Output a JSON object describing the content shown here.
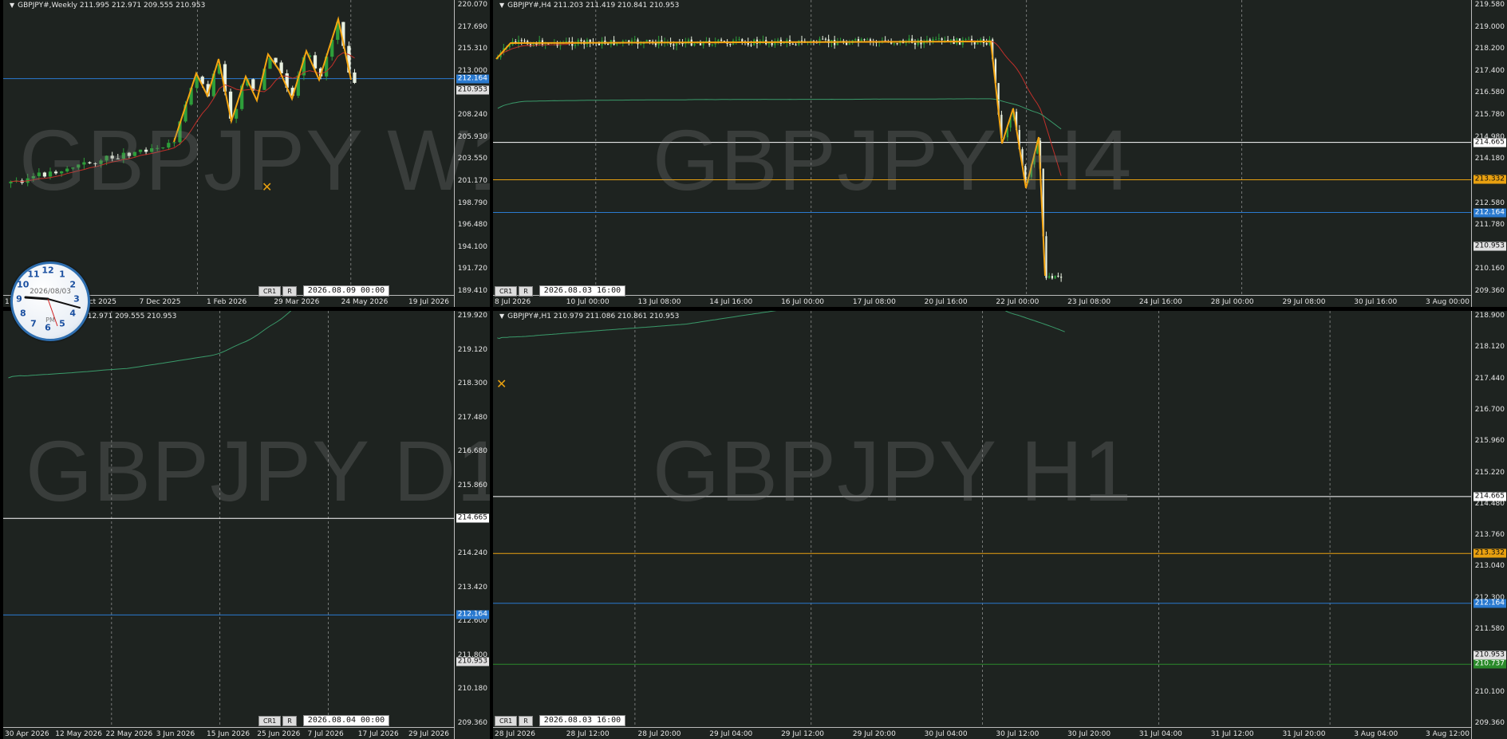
{
  "colors": {
    "bg": "#1e2320",
    "up": "#2e9e3a",
    "down": "#e8f0e0",
    "orange": "#f5a511",
    "ma_red": "#c0302a",
    "ma_green": "#3a9a6a",
    "h_white": "#ffffff",
    "h_orange": "#e8a010",
    "h_blue": "#2a7ad0",
    "h_green": "#2a8a2a"
  },
  "panels": [
    {
      "id": "w1",
      "title": "GBPJPY#,Weekly  211.995 212.971 209.555 210.953",
      "watermark": "GBPJPY W1",
      "price_min": 189.41,
      "price_max": 220.07,
      "y_labels": [
        "220.070",
        "217.690",
        "215.310",
        "213.000",
        "210.630",
        "208.240",
        "205.930",
        "203.550",
        "201.170",
        "198.790",
        "196.480",
        "194.100",
        "191.720",
        "189.410"
      ],
      "badges": [
        {
          "value": "212.164",
          "color": "#2a7ad0",
          "text": "#fff"
        },
        {
          "value": "210.953",
          "color": "#e0e0e0",
          "text": "#111"
        }
      ],
      "hlines": [
        {
          "price": 212.164,
          "color": "#2a7ad0"
        }
      ],
      "x_labels": [
        "17 Aug 2025",
        "12 Oct 2025",
        "7 Dec 2025",
        "1 Feb 2026",
        "29 Mar 2026",
        "24 May 2026",
        "19 Jul 2026"
      ],
      "vlines_frac": [
        0.43,
        0.77
      ],
      "datetime": "2026.08.09 00:00",
      "btn1": "CR1",
      "btn2": "R",
      "zigzag": [
        [
          218,
          178
        ],
        [
          246,
          92
        ],
        [
          260,
          120
        ],
        [
          274,
          74
        ],
        [
          290,
          152
        ],
        [
          308,
          96
        ],
        [
          322,
          126
        ],
        [
          336,
          68
        ],
        [
          350,
          88
        ],
        [
          366,
          124
        ],
        [
          384,
          64
        ],
        [
          400,
          100
        ],
        [
          424,
          24
        ],
        [
          440,
          100
        ]
      ]
    },
    {
      "id": "h4",
      "title": "GBPJPY#,H4  211.203 211.419 210.841 210.953",
      "watermark": "GBPJPY H4",
      "price_min": 209.36,
      "price_max": 219.58,
      "y_labels": [
        "219.580",
        "219.000",
        "218.200",
        "217.400",
        "216.580",
        "215.780",
        "214.980",
        "214.180",
        "213.380",
        "212.580",
        "211.780",
        "210.980",
        "210.160",
        "209.360"
      ],
      "badges": [
        {
          "value": "214.665",
          "color": "#ffffff",
          "text": "#111"
        },
        {
          "value": "213.332",
          "color": "#e8a010",
          "text": "#111"
        },
        {
          "value": "212.164",
          "color": "#2a7ad0",
          "text": "#fff"
        },
        {
          "value": "210.953",
          "color": "#e0e0e0",
          "text": "#111"
        }
      ],
      "hlines": [
        {
          "price": 214.665,
          "color": "#ffffff"
        },
        {
          "price": 213.332,
          "color": "#e8a010"
        },
        {
          "price": 212.164,
          "color": "#2a7ad0"
        }
      ],
      "x_labels": [
        "8 Jul 2026",
        "10 Jul 00:00",
        "13 Jul 08:00",
        "14 Jul 16:00",
        "16 Jul 00:00",
        "17 Jul 08:00",
        "20 Jul 16:00",
        "22 Jul 00:00",
        "23 Jul 08:00",
        "24 Jul 16:00",
        "28 Jul 00:00",
        "29 Jul 08:00",
        "30 Jul 16:00",
        "3 Aug 00:00"
      ],
      "vlines_frac": [
        0.105,
        0.325,
        0.545,
        0.765
      ],
      "datetime": "2026.08.03 16:00",
      "btn1": "CR1",
      "btn2": "R",
      "zigzag": [
        [
          622,
          74
        ],
        [
          640,
          54
        ],
        [
          1242,
          52
        ],
        [
          1256,
          180
        ],
        [
          1270,
          136
        ],
        [
          1286,
          236
        ],
        [
          1302,
          172
        ],
        [
          1310,
          346
        ]
      ]
    },
    {
      "id": "d1",
      "title": "212.971 209.555 210.953",
      "watermark": "GBPJPY D1",
      "price_min": 209.36,
      "price_max": 219.92,
      "y_labels": [
        "219.920",
        "219.120",
        "218.300",
        "217.480",
        "216.680",
        "215.860",
        "215.040",
        "214.240",
        "213.420",
        "212.600",
        "211.800",
        "210.180",
        "209.360"
      ],
      "badges": [
        {
          "value": "214.665",
          "color": "#ffffff",
          "text": "#111"
        },
        {
          "value": "212.164",
          "color": "#2a7ad0",
          "text": "#fff"
        },
        {
          "value": "210.953",
          "color": "#e0e0e0",
          "text": "#111"
        }
      ],
      "hlines": [
        {
          "price": 214.665,
          "color": "#ffffff"
        },
        {
          "price": 212.164,
          "color": "#2a7ad0"
        }
      ],
      "x_labels": [
        "30 Apr 2026",
        "12 May 2026",
        "22 May 2026",
        "3 Jun 2026",
        "15 Jun 2026",
        "25 Jun 2026",
        "7 Jul 2026",
        "17 Jul 2026",
        "29 Jul 2026"
      ],
      "vlines_frac": [
        0.24,
        0.48,
        0.72
      ],
      "datetime": "2026.08.04 00:00",
      "btn1": "CR1",
      "btn2": "R",
      "zigzag": [
        [
          262,
          248
        ],
        [
          290,
          148
        ],
        [
          308,
          172
        ],
        [
          330,
          76
        ],
        [
          348,
          114
        ],
        [
          366,
          22
        ],
        [
          392,
          76
        ],
        [
          420,
          50
        ],
        [
          438,
          190
        ],
        [
          454,
          152
        ],
        [
          458,
          268
        ]
      ]
    },
    {
      "id": "h1",
      "title": "GBPJPY#,H1  210.979 211.086 210.861 210.953",
      "watermark": "GBPJPY H1",
      "price_min": 209.36,
      "price_max": 218.9,
      "y_labels": [
        "218.900",
        "218.120",
        "217.440",
        "216.700",
        "215.960",
        "215.220",
        "214.480",
        "213.760",
        "213.040",
        "212.300",
        "211.580",
        "210.840",
        "210.100",
        "209.360"
      ],
      "badges": [
        {
          "value": "214.665",
          "color": "#ffffff",
          "text": "#111"
        },
        {
          "value": "213.332",
          "color": "#e8a010",
          "text": "#111"
        },
        {
          "value": "212.164",
          "color": "#2a7ad0",
          "text": "#fff"
        },
        {
          "value": "210.953",
          "color": "#e0e0e0",
          "text": "#111"
        },
        {
          "value": "210.737",
          "color": "#2a8a2a",
          "text": "#fff"
        }
      ],
      "hlines": [
        {
          "price": 214.665,
          "color": "#ffffff"
        },
        {
          "price": 213.332,
          "color": "#e8a010"
        },
        {
          "price": 212.164,
          "color": "#2a7ad0"
        },
        {
          "price": 210.737,
          "color": "#2a8a2a"
        }
      ],
      "x_labels": [
        "28 Jul 2026",
        "28 Jul 12:00",
        "28 Jul 20:00",
        "29 Jul 04:00",
        "29 Jul 12:00",
        "29 Jul 20:00",
        "30 Jul 04:00",
        "30 Jul 12:00",
        "30 Jul 20:00",
        "31 Jul 04:00",
        "31 Jul 12:00",
        "31 Jul 20:00",
        "3 Aug 04:00",
        "3 Aug 12:00"
      ],
      "vlines_frac": [
        0.145,
        0.325,
        0.5,
        0.68,
        0.855
      ],
      "datetime": "2026.08.03 16:00",
      "btn1": "CR1",
      "btn2": "R",
      "zigzag": [
        [
          1020,
          130
        ],
        [
          1030,
          200
        ],
        [
          1046,
          156
        ],
        [
          1056,
          180
        ],
        [
          1104,
          100
        ],
        [
          1122,
          130
        ],
        [
          1140,
          118
        ],
        [
          1148,
          190
        ],
        [
          1164,
          140
        ],
        [
          1182,
          196
        ],
        [
          1212,
          158
        ],
        [
          1230,
          254
        ],
        [
          1250,
          232
        ],
        [
          1262,
          352
        ],
        [
          1276,
          300
        ],
        [
          1302,
          306
        ],
        [
          1320,
          284
        ]
      ]
    }
  ],
  "clock": {
    "date": "2026/08/03",
    "ampm": "PM",
    "numbers": [
      "12",
      "1",
      "2",
      "3",
      "4",
      "5",
      "6",
      "7",
      "8",
      "9",
      "10",
      "11"
    ]
  }
}
